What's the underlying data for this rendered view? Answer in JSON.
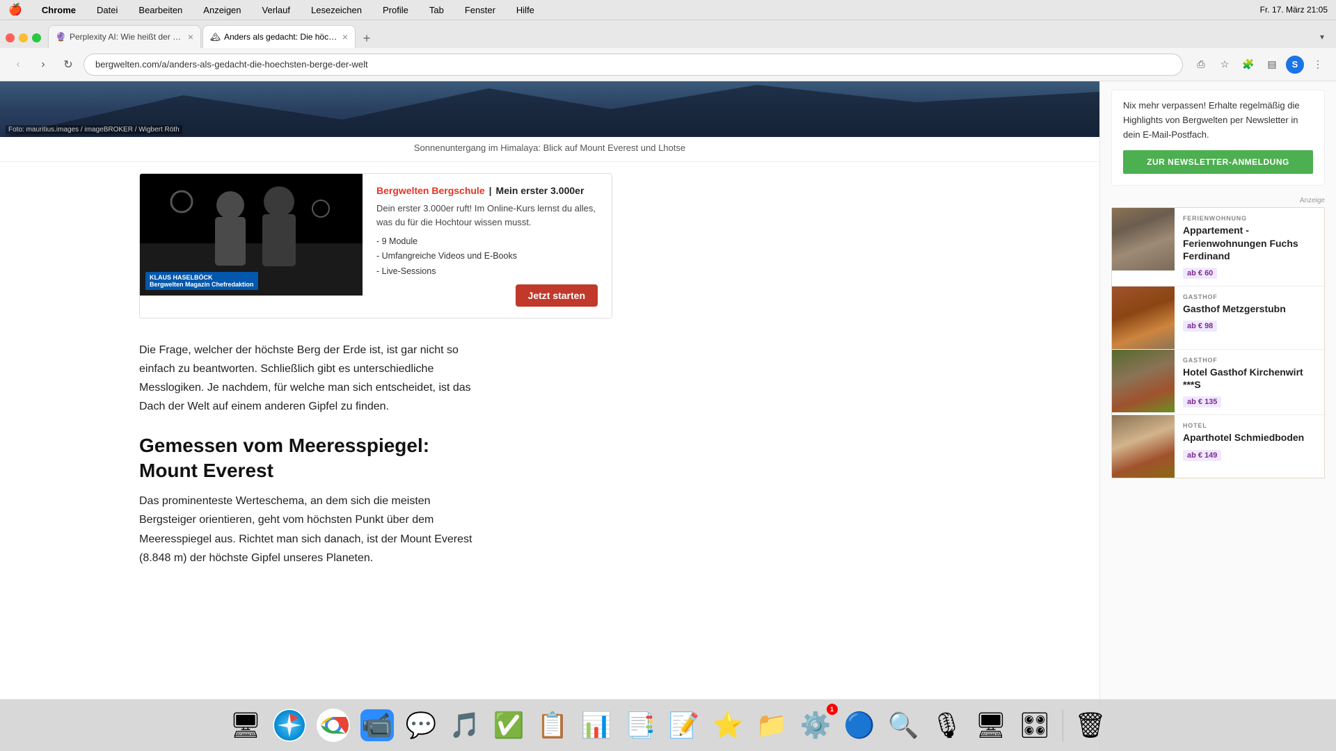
{
  "menubar": {
    "apple": "🍎",
    "app": "Chrome",
    "items": [
      "Datei",
      "Bearbeiten",
      "Anzeigen",
      "Verlauf",
      "Lesezeichen",
      "Profile",
      "Tab",
      "Fenster",
      "Hilfe"
    ],
    "time": "Fr. 17. März  21:05"
  },
  "tabs": [
    {
      "id": "tab1",
      "label": "Perplexity AI: Wie heißt der h...",
      "active": false,
      "favicon": "🔮"
    },
    {
      "id": "tab2",
      "label": "Anders als gedacht: Die höchs...",
      "active": true,
      "favicon": "🏔"
    }
  ],
  "addressbar": {
    "url": "bergwelten.com/a/anders-als-gedacht-die-hoechsten-berge-der-welt"
  },
  "page": {
    "photo_credit": "Foto: mauritius.images / imageBROKER / Wigbert Röth",
    "image_caption": "Sonnenuntergang im Himalaya: Blick auf Mount Everest und Lhotse",
    "course_banner": {
      "brand": "Bergwelten Bergschule",
      "separator": "|",
      "title": "Mein erster 3.000er",
      "desc": "Dein erster 3.000er ruft! Im Online-Kurs lernst du alles, was du für die Hochtour wissen musst.",
      "features": "- 9 Module\n- Umfangreiche Videos und E-Books\n- Live-Sessions",
      "cta": "Jetzt starten",
      "video_label": "KLAUS HASELBÖCK\nBergwelten Magazin Chefredaktion"
    },
    "article_text": "Die Frage, welcher der höchste Berg der Erde ist, ist gar nicht so einfach zu beantworten. Schließlich gibt es unterschiedliche Messlogiken. Je nachdem, für welche man sich entscheidet, ist das Dach der Welt auf einem anderen Gipfel zu finden.",
    "heading": "Gemessen vom Meeresspiegel: Mount Everest",
    "article_text2": "Das prominenteste Werteschema, an dem sich die meisten Bergsteiger orientieren, geht vom höchsten Punkt über dem Meeresspiegel aus. Richtet man sich danach, ist der Mount Everest (8.848 m) der höchste Gipfel unseres Planeten."
  },
  "sidebar": {
    "newsletter": {
      "text": "Nix mehr verpassen! Erhalte regelmäßig die Highlights von Bergwelten per Newsletter in dein E-Mail-Postfach.",
      "cta": "ZUR NEWSLETTER-ANMELDUNG"
    },
    "anzeige": "Anzeige",
    "ads": [
      {
        "category": "FERIENWOHNUNG",
        "title": "Appartement - Ferienwohnungen Fuchs Ferdinand",
        "price": "ab € 60",
        "price_class": "purple"
      },
      {
        "category": "GASTHOF",
        "title": "Gasthof Metzgerstubn",
        "price": "ab € 98",
        "price_class": "purple"
      },
      {
        "category": "GASTHOF",
        "title": "Hotel Gasthof Kirchenwirt ***S",
        "price": "ab € 135",
        "price_class": "purple"
      },
      {
        "category": "HOTEL",
        "title": "Aparthotel Schmiedboden",
        "price": "ab € 149",
        "price_class": "purple"
      }
    ]
  },
  "dock": {
    "items": [
      {
        "name": "finder",
        "emoji": "🖥",
        "label": "Finder"
      },
      {
        "name": "safari",
        "emoji": "🧭",
        "label": "Safari"
      },
      {
        "name": "chrome",
        "emoji": "🌐",
        "label": "Chrome"
      },
      {
        "name": "zoom",
        "emoji": "💬",
        "label": "Zoom"
      },
      {
        "name": "whatsapp",
        "emoji": "📱",
        "label": "WhatsApp"
      },
      {
        "name": "spotify",
        "emoji": "🎵",
        "label": "Spotify"
      },
      {
        "name": "todoist",
        "emoji": "✅",
        "label": "Todoist"
      },
      {
        "name": "trello",
        "emoji": "📋",
        "label": "Trello"
      },
      {
        "name": "excel",
        "emoji": "📊",
        "label": "Excel"
      },
      {
        "name": "powerpoint",
        "emoji": "📑",
        "label": "PowerPoint"
      },
      {
        "name": "word",
        "emoji": "📝",
        "label": "Word"
      },
      {
        "name": "reeder",
        "emoji": "⭐",
        "label": "Reeder"
      },
      {
        "name": "google-drive",
        "emoji": "📁",
        "label": "Google Drive"
      },
      {
        "name": "system-prefs",
        "emoji": "⚙️",
        "label": "System Preferences",
        "badge": "1"
      },
      {
        "name": "mercury",
        "emoji": "🔵",
        "label": "Mercury Weather"
      },
      {
        "name": "proxyman",
        "emoji": "🔍",
        "label": "Proxyman"
      },
      {
        "name": "voice-memos",
        "emoji": "🎙",
        "label": "Voice Memos"
      },
      {
        "name": "apple-configurator",
        "emoji": "🖥",
        "label": "Apple Configurator"
      },
      {
        "name": "controlroom",
        "emoji": "🎛",
        "label": "Control Room"
      },
      {
        "name": "trash",
        "emoji": "🗑",
        "label": "Trash"
      }
    ]
  }
}
